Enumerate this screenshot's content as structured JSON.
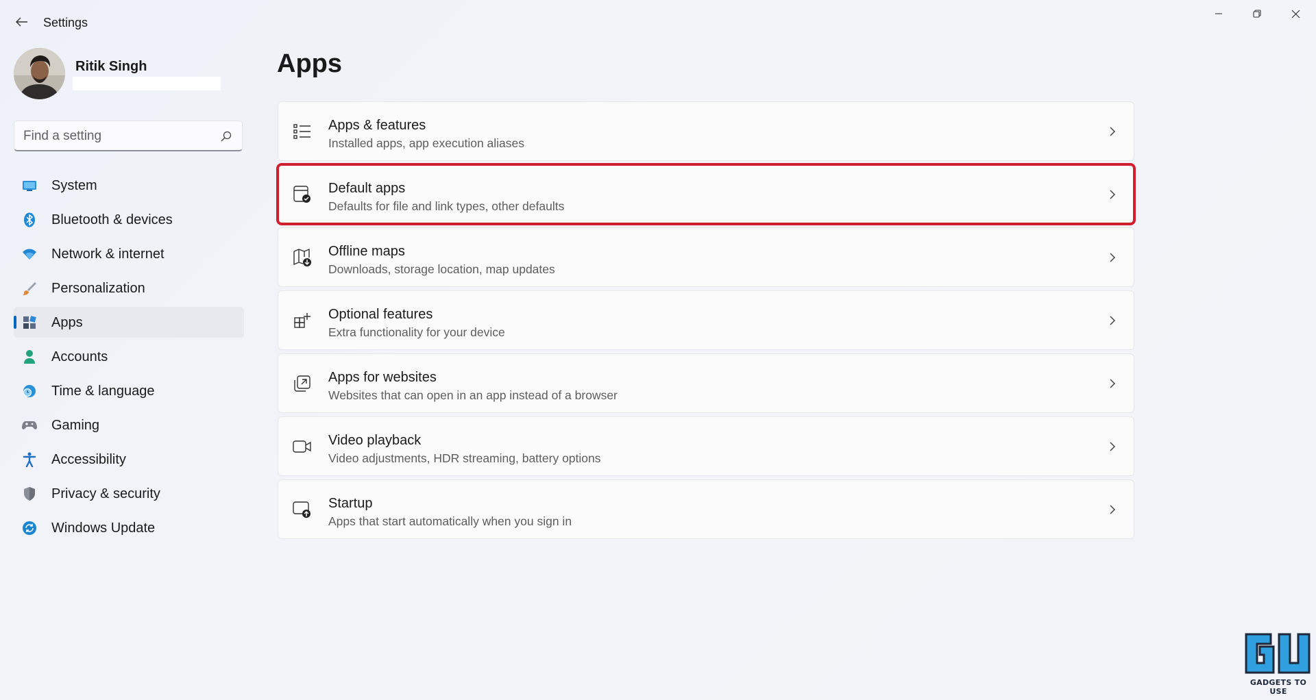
{
  "window": {
    "title": "Settings",
    "controls": [
      "minimize-icon",
      "restore-icon",
      "close-icon"
    ]
  },
  "profile": {
    "name": "Ritik Singh"
  },
  "search": {
    "placeholder": "Find a setting"
  },
  "sidebar": {
    "items": [
      {
        "label": "System",
        "icon": "system-display-icon",
        "color": "#2a8fd6"
      },
      {
        "label": "Bluetooth & devices",
        "icon": "bluetooth-icon",
        "color": "#1e88d9"
      },
      {
        "label": "Network & internet",
        "icon": "wifi-icon",
        "color": "#1f86d4"
      },
      {
        "label": "Personalization",
        "icon": "paintbrush-icon",
        "color": "#e08a3c"
      },
      {
        "label": "Apps",
        "icon": "apps-icon",
        "color": "#5b6b85",
        "active": true
      },
      {
        "label": "Accounts",
        "icon": "person-icon",
        "color": "#23a37e"
      },
      {
        "label": "Time & language",
        "icon": "clock-globe-icon",
        "color": "#2d8fd5"
      },
      {
        "label": "Gaming",
        "icon": "gamepad-icon",
        "color": "#7c7f87"
      },
      {
        "label": "Accessibility",
        "icon": "accessibility-icon",
        "color": "#1f6fc4"
      },
      {
        "label": "Privacy & security",
        "icon": "shield-icon",
        "color": "#7b7f88"
      },
      {
        "label": "Windows Update",
        "icon": "update-icon",
        "color": "#1b86d0"
      }
    ]
  },
  "main": {
    "title": "Apps",
    "cards": [
      {
        "title": "Apps & features",
        "subtitle": "Installed apps, app execution aliases",
        "icon": "list-icon"
      },
      {
        "title": "Default apps",
        "subtitle": "Defaults for file and link types, other defaults",
        "icon": "default-apps-icon",
        "highlighted": true
      },
      {
        "title": "Offline maps",
        "subtitle": "Downloads, storage location, map updates",
        "icon": "offline-map-icon"
      },
      {
        "title": "Optional features",
        "subtitle": "Extra functionality for your device",
        "icon": "optional-features-icon"
      },
      {
        "title": "Apps for websites",
        "subtitle": "Websites that can open in an app instead of a browser",
        "icon": "open-in-app-icon"
      },
      {
        "title": "Video playback",
        "subtitle": "Video adjustments, HDR streaming, battery options",
        "icon": "video-camera-icon"
      },
      {
        "title": "Startup",
        "subtitle": "Apps that start automatically when you sign in",
        "icon": "startup-icon"
      }
    ]
  },
  "watermark": {
    "text": "GADGETS TO USE",
    "highlight_color": "#d0202f"
  }
}
